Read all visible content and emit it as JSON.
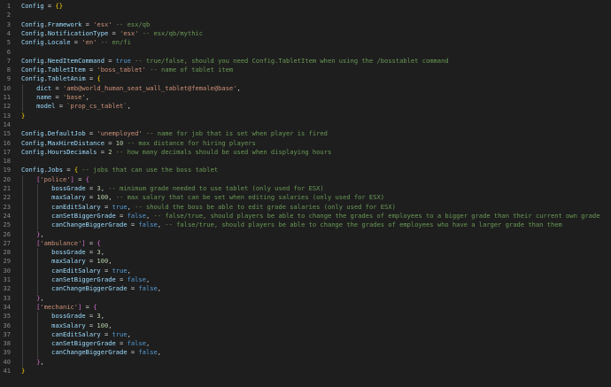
{
  "editor": {
    "language": "lua",
    "colors": {
      "background": "#1e1e1e",
      "line_number": "#858585",
      "variable": "#9cdcfe",
      "string": "#ce9178",
      "number": "#b5cea8",
      "keyword": "#569cd6",
      "comment": "#6a9955",
      "bracket_level_1": "#ffd700",
      "bracket_level_2": "#da70d6",
      "bracket_level_3": "#179fff"
    },
    "lines": [
      {
        "n": "1",
        "tokens": [
          [
            "var",
            "Config"
          ],
          [
            "op",
            " = "
          ],
          [
            "br1",
            "{}"
          ]
        ]
      },
      {
        "n": "2",
        "tokens": []
      },
      {
        "n": "3",
        "tokens": [
          [
            "var",
            "Config"
          ],
          [
            "op",
            "."
          ],
          [
            "prop",
            "Framework"
          ],
          [
            "op",
            " = "
          ],
          [
            "str",
            "'esx'"
          ],
          [
            "cmt",
            " -- esx/qb"
          ]
        ]
      },
      {
        "n": "4",
        "tokens": [
          [
            "var",
            "Config"
          ],
          [
            "op",
            "."
          ],
          [
            "prop",
            "NotificationType"
          ],
          [
            "op",
            " = "
          ],
          [
            "str",
            "'esx'"
          ],
          [
            "cmt",
            " -- esx/qb/mythic"
          ]
        ]
      },
      {
        "n": "5",
        "tokens": [
          [
            "var",
            "Config"
          ],
          [
            "op",
            "."
          ],
          [
            "prop",
            "Locale"
          ],
          [
            "op",
            " = "
          ],
          [
            "str",
            "'en'"
          ],
          [
            "cmt",
            " -- en/fi"
          ]
        ]
      },
      {
        "n": "6",
        "tokens": []
      },
      {
        "n": "7",
        "tokens": [
          [
            "var",
            "Config"
          ],
          [
            "op",
            "."
          ],
          [
            "prop",
            "NeedItemCommand"
          ],
          [
            "op",
            " = "
          ],
          [
            "kw",
            "true"
          ],
          [
            "cmt",
            " -- true/false, should you need Config.TabletItem when using the /bosstablet command"
          ]
        ]
      },
      {
        "n": "8",
        "tokens": [
          [
            "var",
            "Config"
          ],
          [
            "op",
            "."
          ],
          [
            "prop",
            "TabletItem"
          ],
          [
            "op",
            " = "
          ],
          [
            "str",
            "'boss_tablet'"
          ],
          [
            "cmt",
            " -- name of tablet item"
          ]
        ]
      },
      {
        "n": "9",
        "tokens": [
          [
            "var",
            "Config"
          ],
          [
            "op",
            "."
          ],
          [
            "prop",
            "TabletAnim"
          ],
          [
            "op",
            " = "
          ],
          [
            "br1",
            "{"
          ]
        ]
      },
      {
        "n": "10",
        "tokens": [
          [
            "op",
            "    "
          ],
          [
            "prop",
            "dict"
          ],
          [
            "op",
            " = "
          ],
          [
            "str",
            "'amb@world_human_seat_wall_tablet@female@base'"
          ],
          [
            "op",
            ","
          ]
        ]
      },
      {
        "n": "11",
        "tokens": [
          [
            "op",
            "    "
          ],
          [
            "prop",
            "name"
          ],
          [
            "op",
            " = "
          ],
          [
            "str",
            "'base'"
          ],
          [
            "op",
            ","
          ]
        ]
      },
      {
        "n": "12",
        "tokens": [
          [
            "op",
            "    "
          ],
          [
            "prop",
            "model"
          ],
          [
            "op",
            " = "
          ],
          [
            "str",
            "`prop_cs_tablet`"
          ],
          [
            "op",
            ","
          ]
        ]
      },
      {
        "n": "13",
        "tokens": [
          [
            "br1",
            "}"
          ]
        ]
      },
      {
        "n": "14",
        "tokens": []
      },
      {
        "n": "15",
        "tokens": [
          [
            "var",
            "Config"
          ],
          [
            "op",
            "."
          ],
          [
            "prop",
            "DefaultJob"
          ],
          [
            "op",
            " = "
          ],
          [
            "str",
            "'unemployed'"
          ],
          [
            "cmt",
            " -- name for job that is set when player is fired"
          ]
        ]
      },
      {
        "n": "16",
        "tokens": [
          [
            "var",
            "Config"
          ],
          [
            "op",
            "."
          ],
          [
            "prop",
            "MaxHireDistance"
          ],
          [
            "op",
            " = "
          ],
          [
            "num",
            "10"
          ],
          [
            "cmt",
            " -- max distance for hiring players"
          ]
        ]
      },
      {
        "n": "17",
        "tokens": [
          [
            "var",
            "Config"
          ],
          [
            "op",
            "."
          ],
          [
            "prop",
            "HoursDecimals"
          ],
          [
            "op",
            " = "
          ],
          [
            "num",
            "2"
          ],
          [
            "cmt",
            " -- how many decimals should be used when displaying hours"
          ]
        ]
      },
      {
        "n": "18",
        "tokens": []
      },
      {
        "n": "19",
        "tokens": [
          [
            "var",
            "Config"
          ],
          [
            "op",
            "."
          ],
          [
            "prop",
            "Jobs"
          ],
          [
            "op",
            " = "
          ],
          [
            "br1",
            "{"
          ],
          [
            "cmt",
            " -- jobs that can use the boss tablet"
          ]
        ]
      },
      {
        "n": "20",
        "tokens": [
          [
            "op",
            "    "
          ],
          [
            "br2",
            "["
          ],
          [
            "str",
            "'police'"
          ],
          [
            "br2",
            "]"
          ],
          [
            "op",
            " = "
          ],
          [
            "br2",
            "{"
          ]
        ]
      },
      {
        "n": "21",
        "tokens": [
          [
            "op",
            "        "
          ],
          [
            "prop",
            "bossGrade"
          ],
          [
            "op",
            " = "
          ],
          [
            "num",
            "3"
          ],
          [
            "op",
            ","
          ],
          [
            "cmt",
            " -- minimum grade needed to use tablet (only used for ESX)"
          ]
        ]
      },
      {
        "n": "22",
        "tokens": [
          [
            "op",
            "        "
          ],
          [
            "prop",
            "maxSalary"
          ],
          [
            "op",
            " = "
          ],
          [
            "num",
            "100"
          ],
          [
            "op",
            ","
          ],
          [
            "cmt",
            " -- max salary that can be set when editing salaries (only used for ESX)"
          ]
        ]
      },
      {
        "n": "23",
        "tokens": [
          [
            "op",
            "        "
          ],
          [
            "prop",
            "canEditSalary"
          ],
          [
            "op",
            " = "
          ],
          [
            "kw",
            "true"
          ],
          [
            "op",
            ","
          ],
          [
            "cmt",
            " -- should the boss be able to edit grade salaries (only used for ESX)"
          ]
        ]
      },
      {
        "n": "24",
        "tokens": [
          [
            "op",
            "        "
          ],
          [
            "prop",
            "canSetBiggerGrade"
          ],
          [
            "op",
            " = "
          ],
          [
            "kw",
            "false"
          ],
          [
            "op",
            ","
          ],
          [
            "cmt",
            " -- false/true, should players be able to change the grades of employees to a bigger grade than their current own grade"
          ]
        ]
      },
      {
        "n": "25",
        "tokens": [
          [
            "op",
            "        "
          ],
          [
            "prop",
            "canChangeBiggerGrade"
          ],
          [
            "op",
            " = "
          ],
          [
            "kw",
            "false"
          ],
          [
            "op",
            ","
          ],
          [
            "cmt",
            " -- false/true, should players be able to change the grades of employees who have a larger grade than them"
          ]
        ]
      },
      {
        "n": "26",
        "tokens": [
          [
            "op",
            "    "
          ],
          [
            "br2",
            "}"
          ],
          [
            "op",
            ","
          ]
        ]
      },
      {
        "n": "27",
        "tokens": [
          [
            "op",
            "    "
          ],
          [
            "br2",
            "["
          ],
          [
            "str",
            "'ambulance'"
          ],
          [
            "br2",
            "]"
          ],
          [
            "op",
            " = "
          ],
          [
            "br2",
            "{"
          ]
        ]
      },
      {
        "n": "28",
        "tokens": [
          [
            "op",
            "        "
          ],
          [
            "prop",
            "bossGrade"
          ],
          [
            "op",
            " = "
          ],
          [
            "num",
            "3"
          ],
          [
            "op",
            ","
          ]
        ]
      },
      {
        "n": "29",
        "tokens": [
          [
            "op",
            "        "
          ],
          [
            "prop",
            "maxSalary"
          ],
          [
            "op",
            " = "
          ],
          [
            "num",
            "100"
          ],
          [
            "op",
            ","
          ]
        ]
      },
      {
        "n": "30",
        "tokens": [
          [
            "op",
            "        "
          ],
          [
            "prop",
            "canEditSalary"
          ],
          [
            "op",
            " = "
          ],
          [
            "kw",
            "true"
          ],
          [
            "op",
            ","
          ]
        ]
      },
      {
        "n": "31",
        "tokens": [
          [
            "op",
            "        "
          ],
          [
            "prop",
            "canSetBiggerGrade"
          ],
          [
            "op",
            " = "
          ],
          [
            "kw",
            "false"
          ],
          [
            "op",
            ","
          ]
        ]
      },
      {
        "n": "32",
        "tokens": [
          [
            "op",
            "        "
          ],
          [
            "prop",
            "canChangeBiggerGrade"
          ],
          [
            "op",
            " = "
          ],
          [
            "kw",
            "false"
          ],
          [
            "op",
            ","
          ]
        ]
      },
      {
        "n": "33",
        "tokens": [
          [
            "op",
            "    "
          ],
          [
            "br2",
            "}"
          ],
          [
            "op",
            ","
          ]
        ]
      },
      {
        "n": "34",
        "tokens": [
          [
            "op",
            "    "
          ],
          [
            "br2",
            "["
          ],
          [
            "str",
            "'mechanic'"
          ],
          [
            "br2",
            "]"
          ],
          [
            "op",
            " = "
          ],
          [
            "br2",
            "{"
          ]
        ]
      },
      {
        "n": "35",
        "tokens": [
          [
            "op",
            "        "
          ],
          [
            "prop",
            "bossGrade"
          ],
          [
            "op",
            " = "
          ],
          [
            "num",
            "3"
          ],
          [
            "op",
            ","
          ]
        ]
      },
      {
        "n": "36",
        "tokens": [
          [
            "op",
            "        "
          ],
          [
            "prop",
            "maxSalary"
          ],
          [
            "op",
            " = "
          ],
          [
            "num",
            "100"
          ],
          [
            "op",
            ","
          ]
        ]
      },
      {
        "n": "37",
        "tokens": [
          [
            "op",
            "        "
          ],
          [
            "prop",
            "canEditSalary"
          ],
          [
            "op",
            " = "
          ],
          [
            "kw",
            "true"
          ],
          [
            "op",
            ","
          ]
        ]
      },
      {
        "n": "38",
        "tokens": [
          [
            "op",
            "        "
          ],
          [
            "prop",
            "canSetBiggerGrade"
          ],
          [
            "op",
            " = "
          ],
          [
            "kw",
            "false"
          ],
          [
            "op",
            ","
          ]
        ]
      },
      {
        "n": "39",
        "tokens": [
          [
            "op",
            "        "
          ],
          [
            "prop",
            "canChangeBiggerGrade"
          ],
          [
            "op",
            " = "
          ],
          [
            "kw",
            "false"
          ],
          [
            "op",
            ","
          ]
        ]
      },
      {
        "n": "40",
        "tokens": [
          [
            "op",
            "    "
          ],
          [
            "br2",
            "}"
          ],
          [
            "op",
            ","
          ]
        ]
      },
      {
        "n": "41",
        "tokens": [
          [
            "br1",
            "}"
          ]
        ]
      }
    ]
  }
}
